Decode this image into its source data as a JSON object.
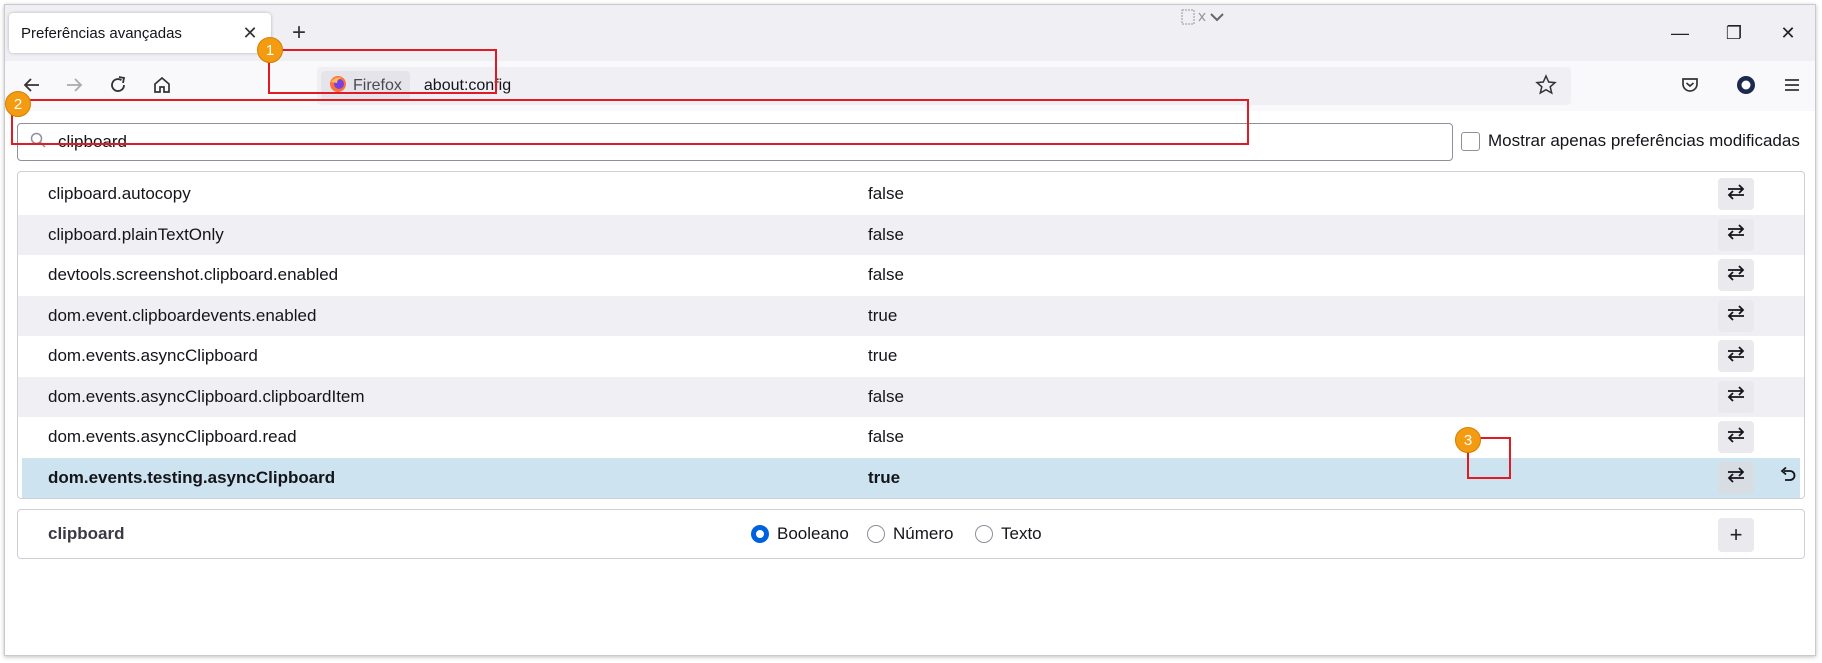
{
  "tab": {
    "title": "Preferências avançadas",
    "close_glyph": "✕",
    "new_glyph": "+"
  },
  "window_controls": {
    "minimize": "—",
    "maximize": "❐",
    "close": "✕"
  },
  "urlbar": {
    "identity_label": "Firefox",
    "url": "about:config"
  },
  "annotations": {
    "badge1": "1",
    "badge2": "2",
    "badge3": "3"
  },
  "search": {
    "value": "clipboard"
  },
  "filter": {
    "label": "Mostrar apenas preferências modificadas",
    "checked": false
  },
  "prefs": [
    {
      "name": "clipboard.autocopy",
      "value": "false"
    },
    {
      "name": "clipboard.plainTextOnly",
      "value": "false"
    },
    {
      "name": "devtools.screenshot.clipboard.enabled",
      "value": "false"
    },
    {
      "name": "dom.event.clipboardevents.enabled",
      "value": "true"
    },
    {
      "name": "dom.events.asyncClipboard",
      "value": "true"
    },
    {
      "name": "dom.events.asyncClipboard.clipboardItem",
      "value": "false"
    },
    {
      "name": "dom.events.asyncClipboard.read",
      "value": "false"
    },
    {
      "name": "dom.events.testing.asyncClipboard",
      "value": "true",
      "modified": true
    }
  ],
  "add_pref": {
    "name": "clipboard",
    "types": [
      "Booleano",
      "Número",
      "Texto"
    ],
    "selected_type": "Booleano",
    "add_glyph": "+"
  },
  "colors": {
    "accent": "#0061e0",
    "annotation": "#e01b24",
    "badge": "#f39c12",
    "selected_row": "#cde4f0"
  }
}
